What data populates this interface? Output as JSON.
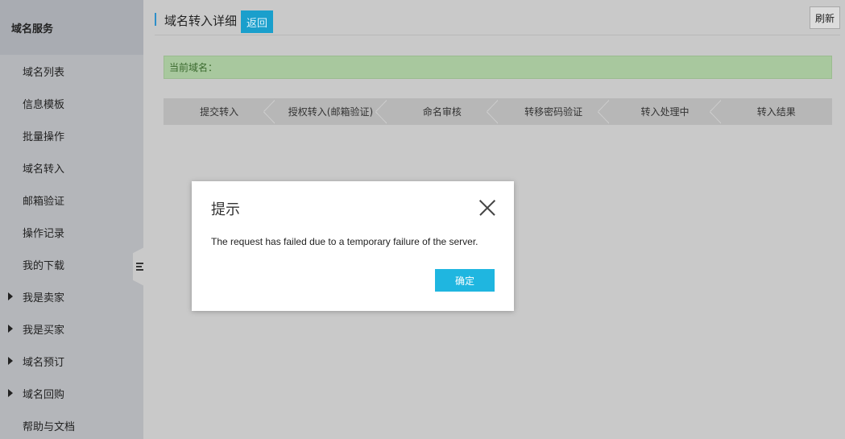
{
  "sidebar": {
    "header": "域名服务",
    "items": [
      {
        "label": "域名列表",
        "expandable": false
      },
      {
        "label": "信息模板",
        "expandable": false
      },
      {
        "label": "批量操作",
        "expandable": false
      },
      {
        "label": "域名转入",
        "expandable": false
      },
      {
        "label": "邮箱验证",
        "expandable": false
      },
      {
        "label": "操作记录",
        "expandable": false
      },
      {
        "label": "我的下载",
        "expandable": false
      },
      {
        "label": "我是卖家",
        "expandable": true
      },
      {
        "label": "我是买家",
        "expandable": true
      },
      {
        "label": "域名预订",
        "expandable": true
      },
      {
        "label": "域名回购",
        "expandable": true
      },
      {
        "label": "帮助与文档",
        "expandable": false
      }
    ]
  },
  "header": {
    "title": "域名转入详细",
    "back_label": "返回",
    "refresh_label": "刷新"
  },
  "domain_bar": {
    "label": "当前域名："
  },
  "steps": [
    "提交转入",
    "授权转入(邮箱验证)",
    "命名审核",
    "转移密码验证",
    "转入处理中",
    "转入结果"
  ],
  "modal": {
    "title": "提示",
    "message": "The request has failed due to a temporary failure of the server.",
    "ok_label": "确定"
  },
  "colors": {
    "accent": "#1a9fcc",
    "ok_button": "#1fb6e0",
    "domain_bar_bg": "#a8c89e",
    "overlay": "#c9c9c9"
  }
}
